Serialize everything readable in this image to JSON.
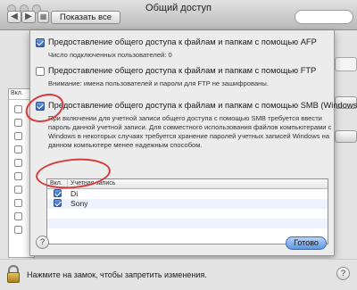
{
  "window": {
    "title": "Общий доступ",
    "show_all_label": "Показать все",
    "back_glyph": "◀",
    "forward_glyph": "▶"
  },
  "sheet": {
    "options": [
      {
        "label": "Предоставление общего доступа к файлам и папкам с помощью AFP",
        "checked": true,
        "note": "Число подключенных пользователей: 0"
      },
      {
        "label": "Предоставление общего доступа к файлам и папкам с помощью FTP",
        "checked": false,
        "note": "Внимание: имена пользователей и пароли для FTP не зашифрованы."
      },
      {
        "label": "Предоставление общего доступа к файлам и папкам с помощью SMB (Windows)",
        "checked": true,
        "note_lines": [
          "При включении для учетной записи общего доступа с помощью SMB требуется ввести",
          "пароль данной учетной записи. Для совместного использования файлов компьютерами с",
          "Windows в некоторых случаях требуется хранение паролей учетных записей Windows на",
          "данном компьютере менее надежным способом."
        ]
      }
    ],
    "accounts_table": {
      "col_enabled": "Вкл.",
      "col_account": "Учетная запись",
      "rows": [
        {
          "name": "Di",
          "checked": true
        },
        {
          "name": "Sony",
          "checked": true
        }
      ]
    },
    "help_glyph": "?",
    "done_label": "Готово"
  },
  "background": {
    "list_header": "Вкл."
  },
  "bottom": {
    "lock_text": "Нажмите на замок, чтобы запретить изменения.",
    "help_glyph": "?"
  },
  "colors": {
    "annotation": "#d63b3b",
    "accent": "#3b6bb7"
  },
  "icons": [
    "lock-icon",
    "help-icon",
    "back-arrow-icon",
    "forward-arrow-icon",
    "grid-icon"
  ]
}
